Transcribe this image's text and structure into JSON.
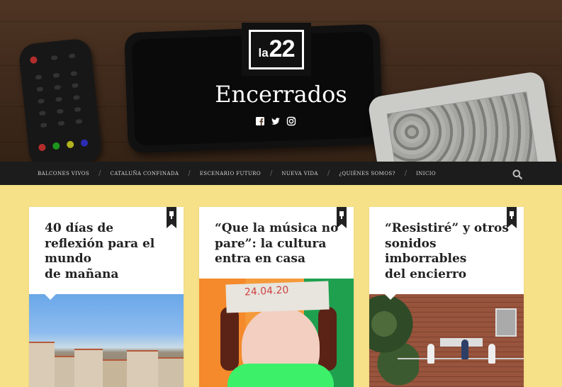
{
  "site": {
    "logo_text": "la22",
    "title": "Encerrados"
  },
  "social": {
    "icons": [
      "facebook-icon",
      "twitter-icon",
      "instagram-icon"
    ]
  },
  "nav": {
    "items": [
      {
        "label": "BALCONES VIVOS"
      },
      {
        "label": "CATALUÑA CONFINADA"
      },
      {
        "label": "ESCENARIO FUTURO"
      },
      {
        "label": "NUEVA VIDA"
      },
      {
        "label": "¿QUIÉNES SOMOS?"
      },
      {
        "label": "INICIO"
      }
    ],
    "separator": "/",
    "search_icon": "search-icon"
  },
  "posts": [
    {
      "title_line1": "40 días de",
      "title_line2": "reflexión para el",
      "title_line3": "mundo",
      "title_line4": "de mañana",
      "sticky_icon": "pin-icon"
    },
    {
      "title_line1": "“Que la música no",
      "title_line2": "pare”: la cultura",
      "title_line3": "entra en casa",
      "title_line4": "",
      "sticky_icon": "pin-icon"
    },
    {
      "title_line1": "“Resistiré” y otros",
      "title_line2": "sonidos",
      "title_line3": "imborrables",
      "title_line4": "del encierro",
      "sticky_icon": "pin-icon"
    }
  ],
  "thumb_texts": {
    "paper_date": "24.04.20"
  },
  "colors": {
    "page_background": "#f6e088",
    "nav_background": "#1c1c1c",
    "card_background": "#ffffff"
  }
}
